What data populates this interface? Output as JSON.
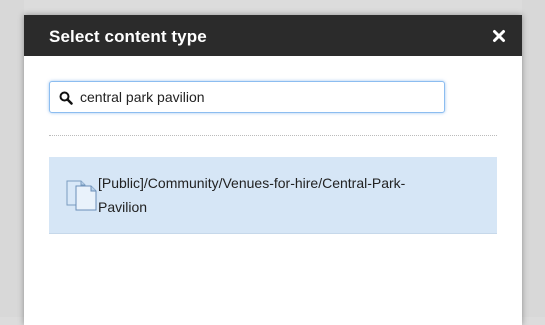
{
  "dialog": {
    "title": "Select content type",
    "close_icon": "close-icon"
  },
  "search": {
    "value": "central park pavilion",
    "icon": "search-icon"
  },
  "results": [
    {
      "label": "[Public]/Community/Venues-for-hire/Central-Park-Pavilion",
      "icon": "documents-icon"
    }
  ],
  "colors": {
    "titlebar": "#2b2b2b",
    "selected_row": "#d6e6f6",
    "focus_border": "#8cbdf0"
  }
}
